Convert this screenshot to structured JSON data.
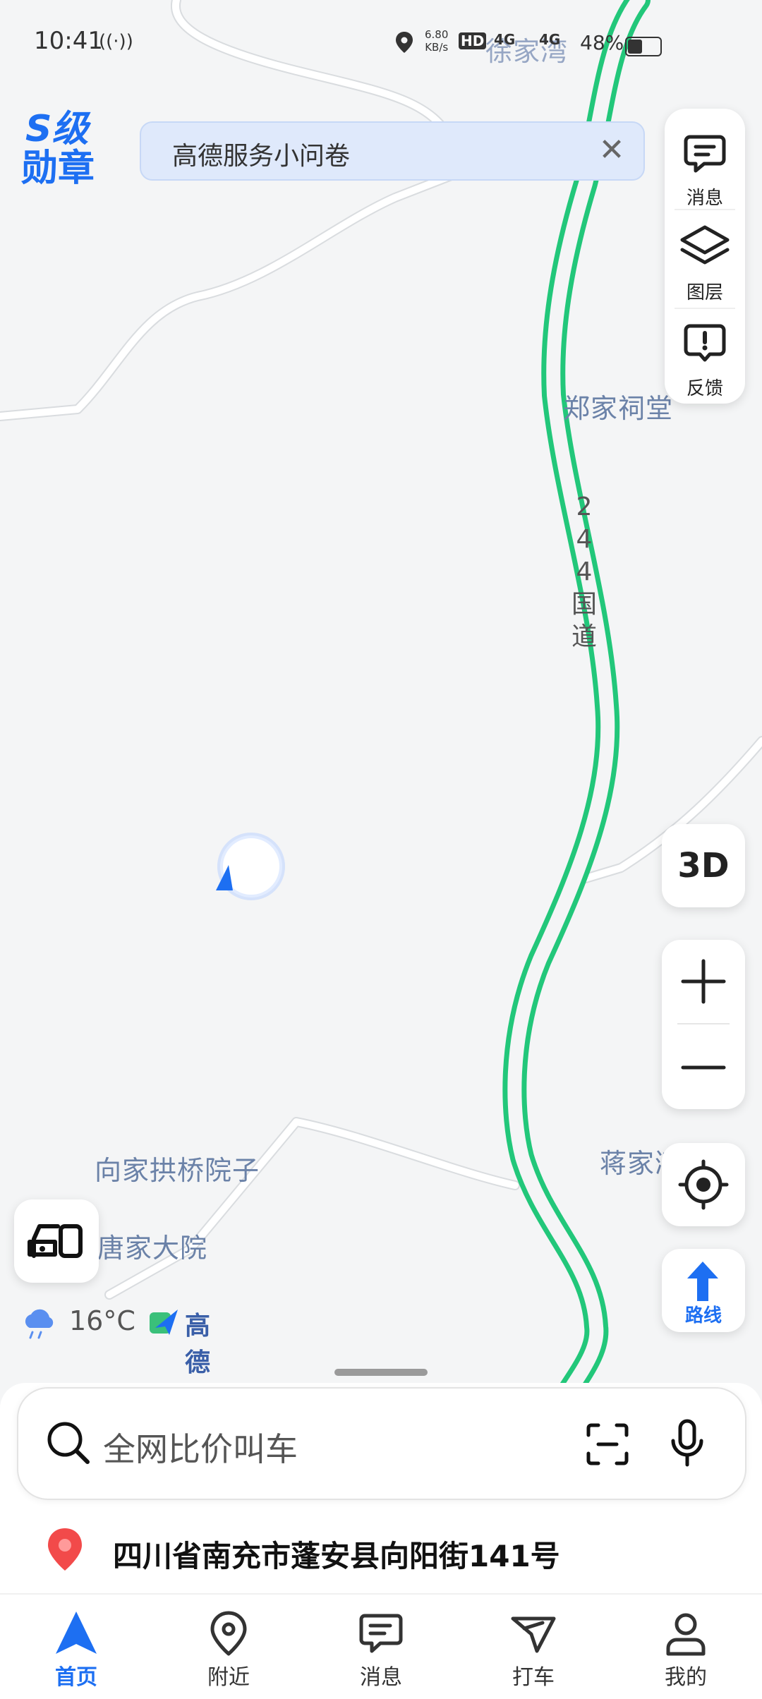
{
  "status_bar": {
    "time": "10:41",
    "net_speed_value": "6.80",
    "net_speed_unit": "KB/s",
    "hd": "HD",
    "network_1": "4G",
    "network_2": "4G",
    "battery": "48%"
  },
  "map": {
    "pois": [
      "郑家祠堂",
      "向家拱桥院子",
      "唐家大院",
      "蒋家湾",
      "徐家湾"
    ],
    "road_label": [
      "2",
      "4",
      "4",
      "国",
      "道"
    ]
  },
  "badge": {
    "line1": "S级",
    "line2": "勋章"
  },
  "survey_banner": {
    "text": "高德服务小问卷"
  },
  "right_toolbar": {
    "messages": "消息",
    "layers": "图层",
    "feedback": "反馈"
  },
  "controls": {
    "three_d": "3D",
    "route": "路线"
  },
  "weather": {
    "temp": "16°C"
  },
  "brand": {
    "name": "高德地图"
  },
  "search": {
    "placeholder": "全网比价叫车"
  },
  "current_address": "四川省南充市蓬安县向阳街141号",
  "tabs": [
    {
      "label": "首页",
      "active": true
    },
    {
      "label": "附近",
      "active": false
    },
    {
      "label": "消息",
      "active": false
    },
    {
      "label": "打车",
      "active": false
    },
    {
      "label": "我的",
      "active": false
    }
  ],
  "colors": {
    "accent": "#1d6ff2",
    "highway": "#22c77a",
    "location_pin": "#f24a4a"
  }
}
